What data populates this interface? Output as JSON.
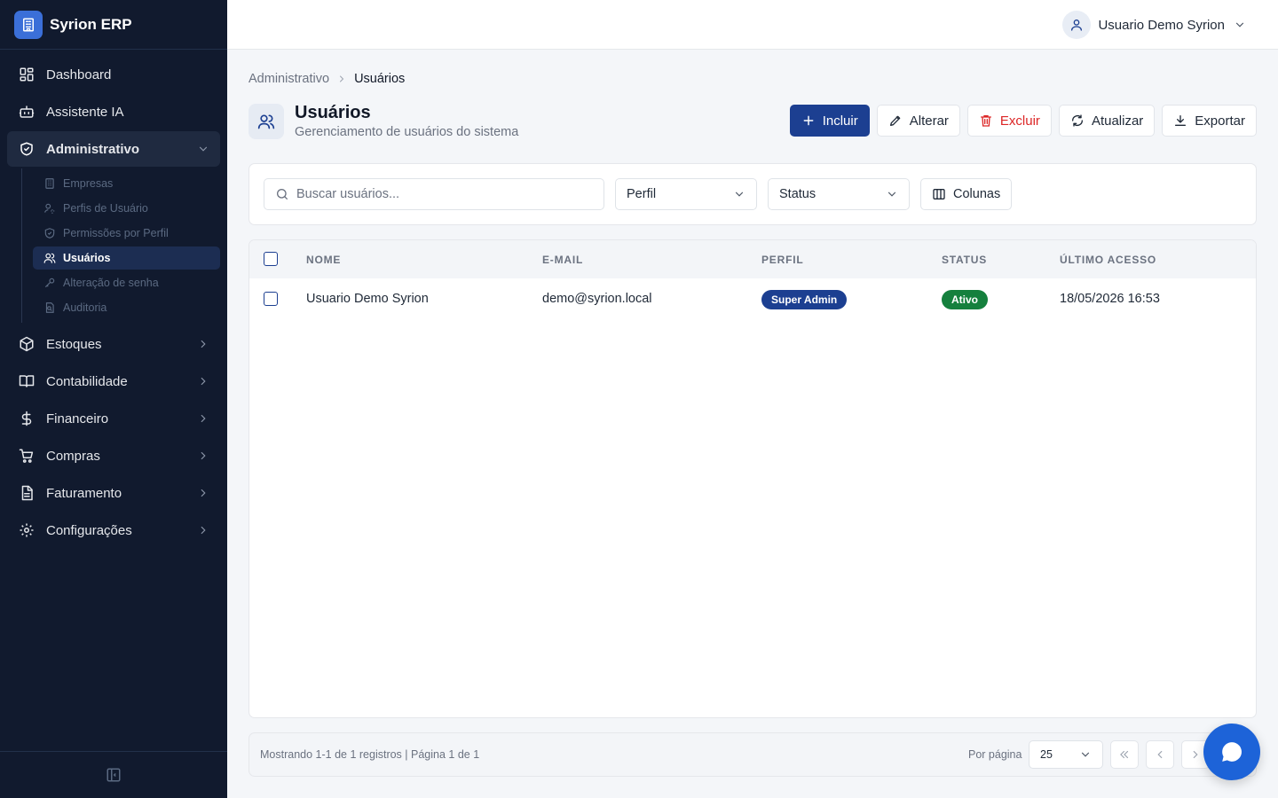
{
  "app": {
    "name": "Syrion ERP"
  },
  "user": {
    "name": "Usuario Demo Syrion"
  },
  "sidebar": {
    "items": [
      {
        "label": "Dashboard"
      },
      {
        "label": "Assistente IA"
      },
      {
        "label": "Administrativo"
      },
      {
        "label": "Estoques"
      },
      {
        "label": "Contabilidade"
      },
      {
        "label": "Financeiro"
      },
      {
        "label": "Compras"
      },
      {
        "label": "Faturamento"
      },
      {
        "label": "Configurações"
      }
    ],
    "sub_items": [
      {
        "label": "Empresas"
      },
      {
        "label": "Perfis de Usuário"
      },
      {
        "label": "Permissões por Perfil"
      },
      {
        "label": "Usuários"
      },
      {
        "label": "Alteração de senha"
      },
      {
        "label": "Auditoria"
      }
    ]
  },
  "breadcrumb": {
    "parent": "Administrativo",
    "current": "Usuários"
  },
  "page": {
    "title": "Usuários",
    "subtitle": "Gerenciamento de usuários do sistema"
  },
  "actions": {
    "include": "Incluir",
    "edit": "Alterar",
    "delete": "Excluir",
    "refresh": "Atualizar",
    "export": "Exportar"
  },
  "filters": {
    "search_placeholder": "Buscar usuários...",
    "profile": "Perfil",
    "status": "Status",
    "columns": "Colunas"
  },
  "table": {
    "headers": {
      "name": "Nome",
      "email": "E-mail",
      "profile": "Perfil",
      "status": "Status",
      "last_access": "Último acesso"
    },
    "rows": [
      {
        "name": "Usuario Demo Syrion",
        "email": "demo@syrion.local",
        "profile": "Super Admin",
        "status": "Ativo",
        "last_access": "18/05/2026 16:53"
      }
    ]
  },
  "footer": {
    "showing": "Mostrando 1-1 de 1 registros | Página 1 de 1",
    "per_page_label": "Por página",
    "per_page_value": "25"
  },
  "colors": {
    "sidebar_bg": "#111a2e",
    "primary": "#1c3f91",
    "danger": "#dc2626",
    "badge_profile": "#1c3f91",
    "badge_active": "#15803d",
    "fab": "#1d63d8"
  }
}
